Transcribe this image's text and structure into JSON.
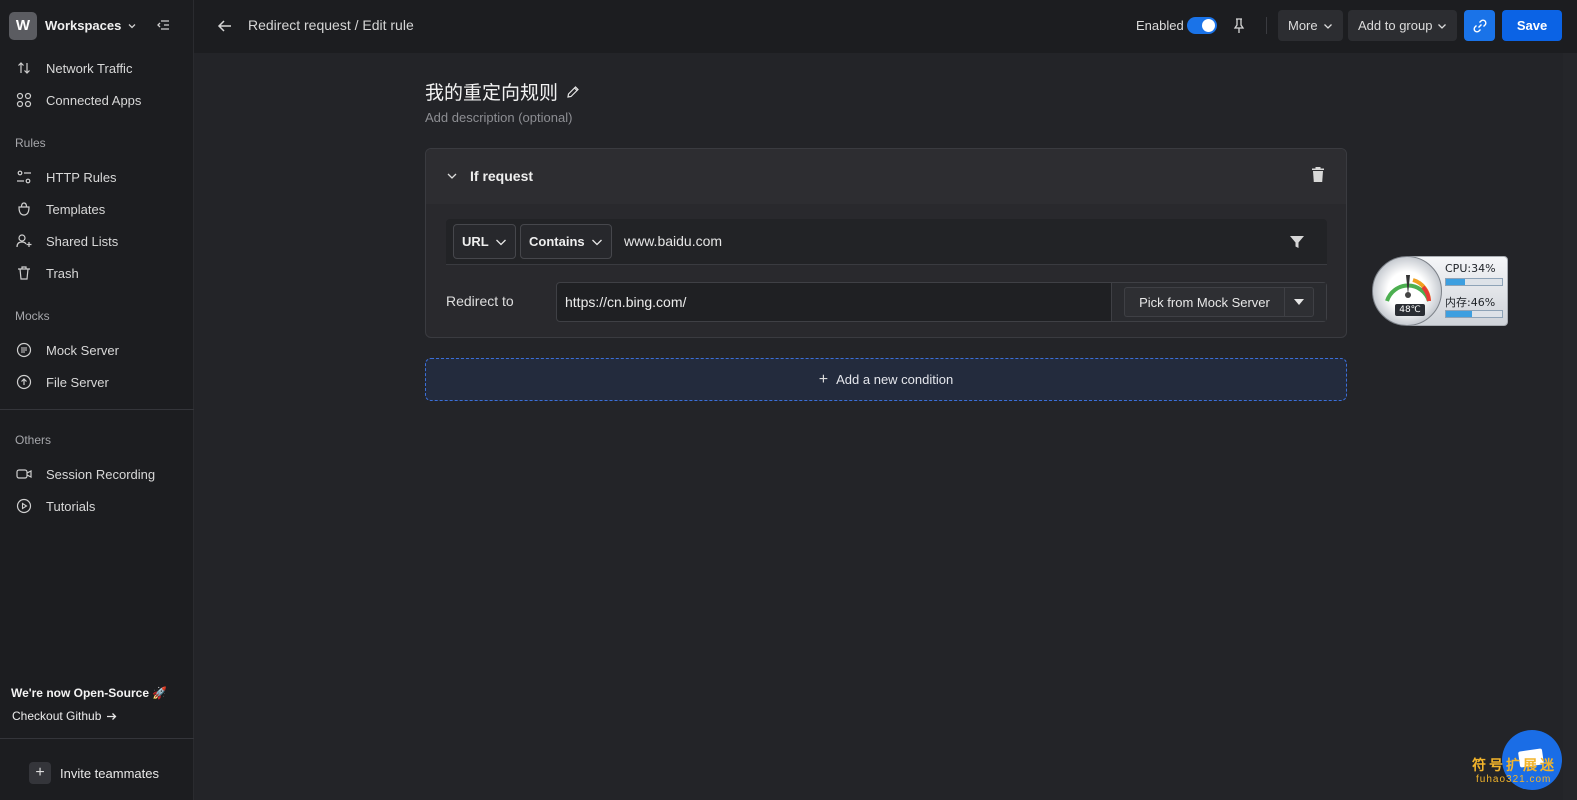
{
  "workspace": {
    "avatar_letter": "W",
    "name": "Workspaces"
  },
  "sidebar": {
    "top_items": [
      {
        "label": "Network Traffic",
        "icon": "arrows-updown-icon"
      },
      {
        "label": "Connected Apps",
        "icon": "grid-icon"
      }
    ],
    "rules_section": "Rules",
    "rules_items": [
      {
        "label": "HTTP Rules",
        "icon": "sliders-icon"
      },
      {
        "label": "Templates",
        "icon": "bag-icon"
      },
      {
        "label": "Shared Lists",
        "icon": "user-plus-icon"
      },
      {
        "label": "Trash",
        "icon": "trash-icon"
      }
    ],
    "mocks_section": "Mocks",
    "mocks_items": [
      {
        "label": "Mock Server",
        "icon": "list-circle-icon"
      },
      {
        "label": "File Server",
        "icon": "upload-circle-icon"
      }
    ],
    "others_section": "Others",
    "others_items": [
      {
        "label": "Session Recording",
        "icon": "video-icon"
      },
      {
        "label": "Tutorials",
        "icon": "play-circle-icon"
      }
    ],
    "open_source_text": "We're now Open-Source 🚀",
    "checkout_text": "Checkout Github",
    "invite_label": "Invite teammates"
  },
  "header": {
    "breadcrumb": "Redirect request / Edit rule",
    "enabled_label": "Enabled",
    "enabled": true,
    "more_label": "More",
    "add_to_group_label": "Add to group",
    "save_label": "Save"
  },
  "rule": {
    "title": "我的重定向规则",
    "description_placeholder": "Add description (optional)",
    "if_request_label": "If request",
    "condition": {
      "field": "URL",
      "operator": "Contains",
      "value": "www.baidu.com"
    },
    "redirect_label": "Redirect to",
    "redirect_value": "https://cn.bing.com/",
    "pick_label": "Pick from Mock Server",
    "add_condition_label": "Add a new condition"
  },
  "widget": {
    "cpu_label": "CPU:34%",
    "cpu_value": 34,
    "mem_label": "内存:46%",
    "mem_value": 46,
    "temp_label": "48℃"
  },
  "watermark": {
    "cn": "符号扩展迷",
    "url": "fuhao321.com"
  },
  "colors": {
    "accent": "#1a73e8",
    "save": "#0b63e5",
    "background": "#232428",
    "sidebar": "#1c1d20"
  }
}
